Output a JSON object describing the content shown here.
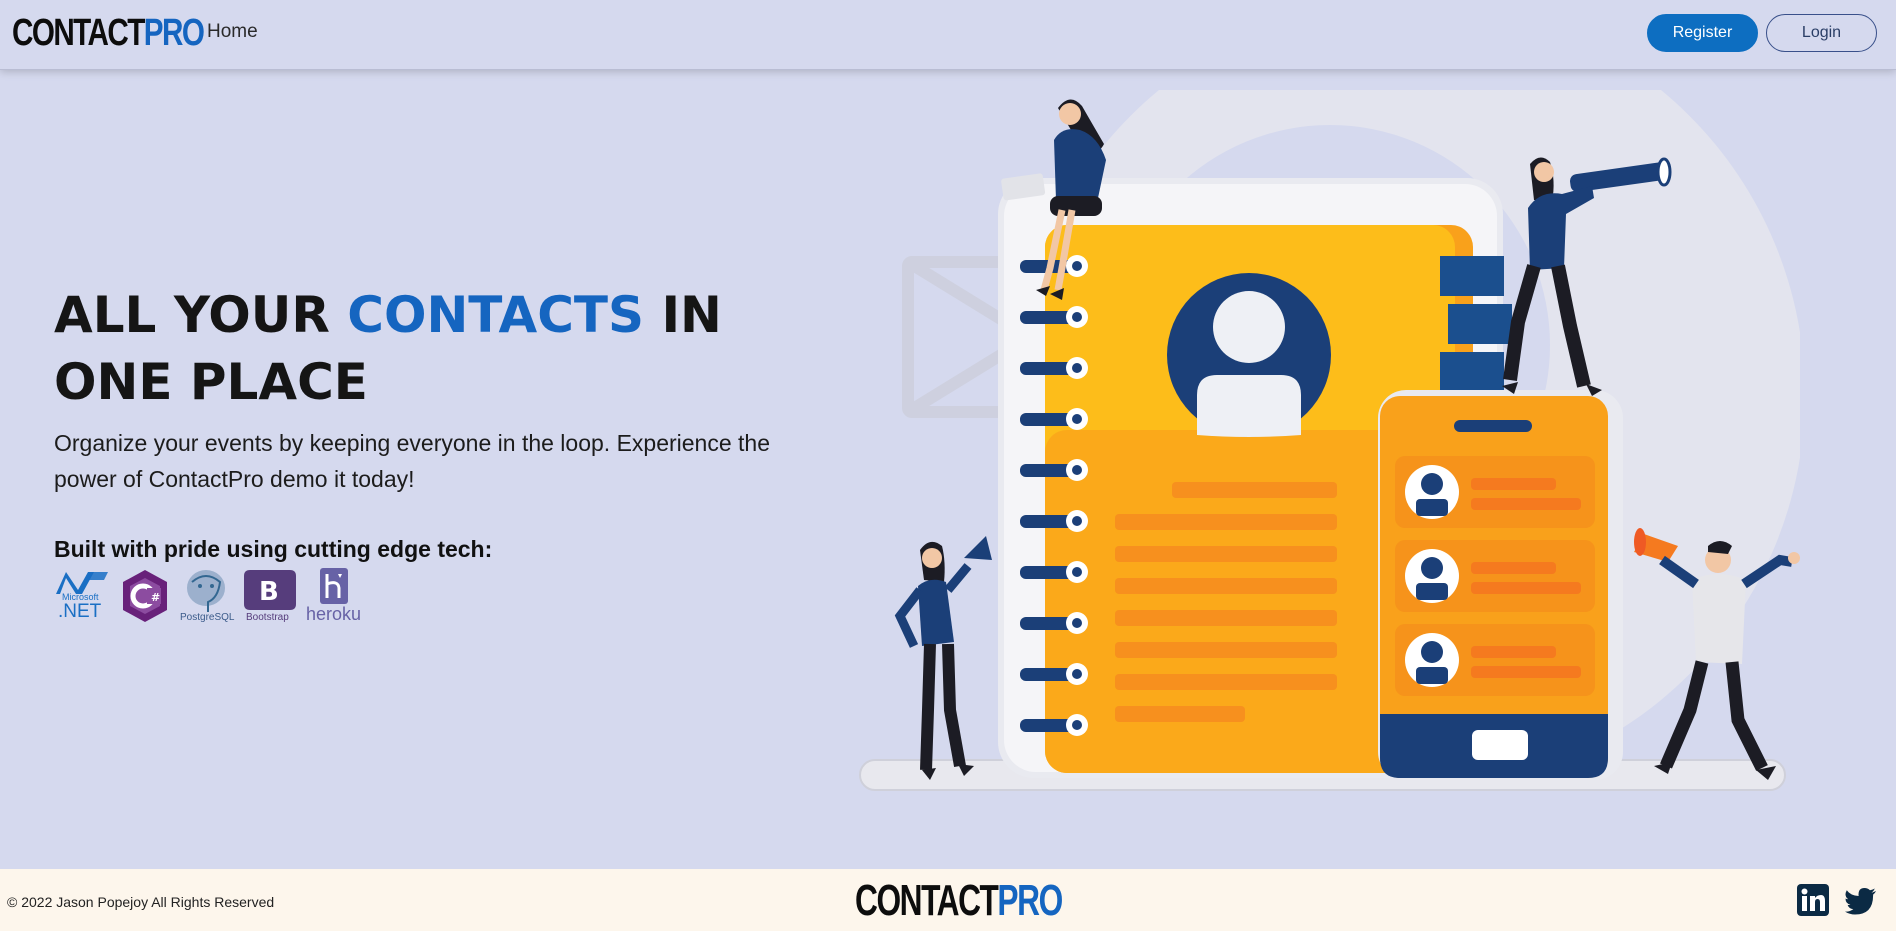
{
  "navbar": {
    "brand_part1": "CONTACT",
    "brand_part2": "PRO",
    "home_label": "Home",
    "register_label": "Register",
    "login_label": "Login"
  },
  "hero": {
    "title_part1": "ALL YOUR ",
    "title_accent": "CONTACTS",
    "title_part2": " IN ONE PLACE",
    "subtitle": "Organize your events by keeping everyone in the loop. Experience the power of ContactPro demo it today!",
    "built_with": "Built with pride using cutting edge tech:",
    "tech": [
      {
        "name": "Microsoft .NET",
        "caption_small": "Microsoft",
        "caption": ".NET"
      },
      {
        "name": "C#",
        "caption": "C#"
      },
      {
        "name": "PostgreSQL",
        "caption": "PostgreSQL"
      },
      {
        "name": "Bootstrap",
        "caption": "Bootstrap"
      },
      {
        "name": "Heroku",
        "caption": "heroku"
      }
    ]
  },
  "footer": {
    "copyright": "© 2022 Jason Popejoy All Rights Reserved",
    "brand_part1": "CONTACT",
    "brand_part2": "PRO",
    "social": [
      "linkedin-icon",
      "twitter-icon"
    ]
  },
  "colors": {
    "background": "#d5d9ee",
    "accent": "#1565c0",
    "footer_bg": "#fdf6ec",
    "illustration_orange": "#f9a11b",
    "illustration_navy": "#1b3f78"
  }
}
